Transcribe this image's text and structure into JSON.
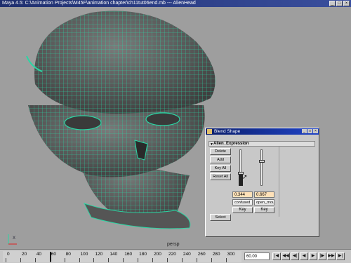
{
  "window": {
    "title": "Maya 4.5: C:\\Animation Projects\\M45F\\animation chapter\\ch11tut06end.mb  ---  AlienHead",
    "min": "_",
    "max": "□",
    "close": "×"
  },
  "viewport": {
    "camera_label": "persp",
    "axis_label": "X"
  },
  "blend_shape": {
    "title": "Blend Shape",
    "menu_icon": "▼",
    "expression_name": "Alien_Expression",
    "buttons": {
      "delete": "Delete",
      "add": "Add",
      "key_all": "Key All",
      "reset_all": "Reset All",
      "select": "Select"
    },
    "targets": [
      {
        "value": "0.344",
        "name": "confused",
        "key_label": "Key",
        "level": 0.344
      },
      {
        "value": "0.667",
        "name": "open_mouth",
        "key_label": "Key",
        "level": 0.667
      }
    ],
    "title_btns": [
      "_",
      "□",
      "×"
    ]
  },
  "timeline": {
    "ticks": [
      "0",
      "20",
      "40",
      "60",
      "80",
      "100",
      "120",
      "140",
      "160",
      "180",
      "200",
      "220",
      "240",
      "260",
      "280",
      "300"
    ],
    "current_frame": "60.00",
    "playback": [
      "|◀",
      "◀◀",
      "◀|",
      "◀",
      "▶",
      "|▶",
      "▶▶",
      "▶|"
    ]
  }
}
